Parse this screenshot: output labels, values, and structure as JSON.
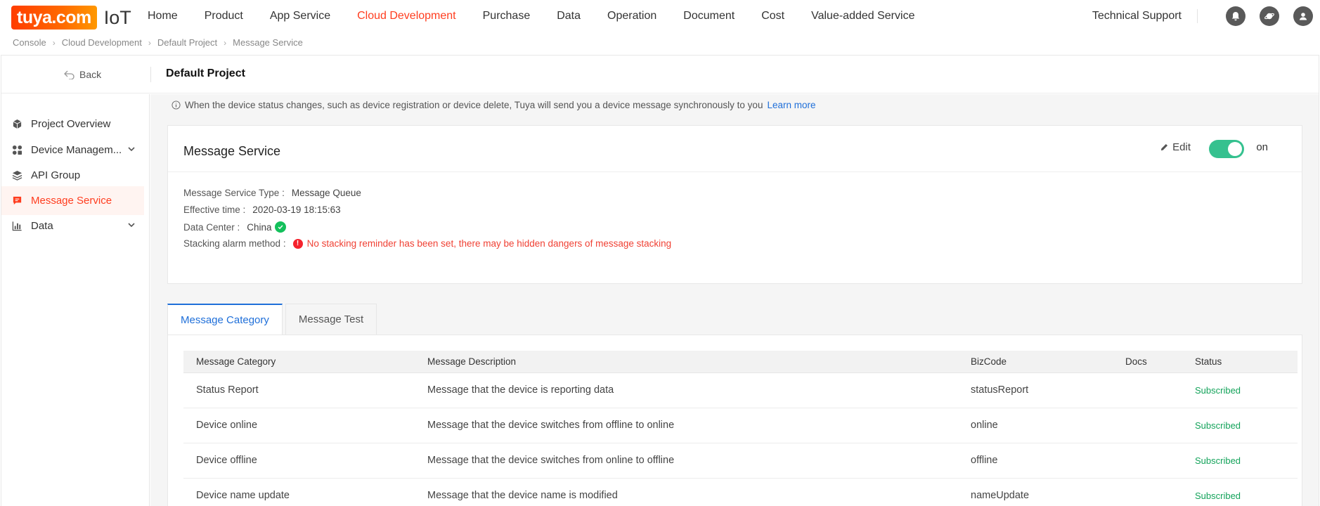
{
  "logo": {
    "brand": "tuya.com",
    "product": "IoT"
  },
  "nav": {
    "items": [
      "Home",
      "Product",
      "App Service",
      "Cloud Development",
      "Purchase",
      "Data",
      "Operation",
      "Document",
      "Cost",
      "Value-added Service"
    ],
    "active": "Cloud Development",
    "tech_support": "Technical Support"
  },
  "breadcrumb": [
    "Console",
    "Cloud Development",
    "Default Project",
    "Message Service"
  ],
  "header": {
    "back_label": "Back",
    "project_title": "Default Project"
  },
  "sidebar": {
    "items": [
      {
        "label": "Project Overview",
        "icon": "cube-icon"
      },
      {
        "label": "Device Managem...",
        "icon": "grid-icon"
      },
      {
        "label": "API Group",
        "icon": "layers-icon"
      },
      {
        "label": "Message Service",
        "icon": "message-icon"
      },
      {
        "label": "Data",
        "icon": "bar-chart-icon"
      }
    ]
  },
  "info": {
    "text": "When the device status changes, such as device registration or device delete, Tuya will send you a device message synchronously to you",
    "link": "Learn more"
  },
  "card": {
    "title": "Message Service",
    "edit_label": "Edit",
    "toggle_label": "on",
    "fields": {
      "type_label": "Message Service Type :",
      "type_value": "Message Queue",
      "time_label": "Effective time :",
      "time_value": "2020-03-19 18:15:63",
      "dc_label": "Data Center :",
      "dc_value": "China",
      "alarm_label": "Stacking alarm method :",
      "alarm_value": "No stacking reminder has been set, there may be hidden dangers of message stacking"
    }
  },
  "tabs": [
    "Message Category",
    "Message Test"
  ],
  "table": {
    "headers": [
      "Message Category",
      "Message Description",
      "BizCode",
      "Docs",
      "Status"
    ],
    "rows": [
      [
        "Status Report",
        "Message that the device is reporting data",
        "statusReport",
        "",
        "Subscribed"
      ],
      [
        "Device online",
        "Message that the device switches from offline to online",
        "online",
        "",
        "Subscribed"
      ],
      [
        "Device offline",
        "Message that the device switches from online to offline",
        "offline",
        "",
        "Subscribed"
      ],
      [
        "Device name update",
        "Message that the device name is modified",
        "nameUpdate",
        "",
        "Subscribed"
      ]
    ]
  },
  "colors": {
    "brand": "#ff3d1f",
    "link": "#1f6fd9",
    "toggle": "#35c18f",
    "subscribed": "#13a35a",
    "warning": "#f04134"
  }
}
